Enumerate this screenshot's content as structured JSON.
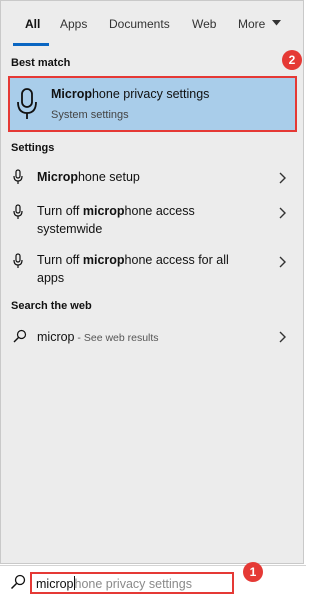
{
  "tabs": [
    {
      "label": "All"
    },
    {
      "label": "Apps"
    },
    {
      "label": "Documents"
    },
    {
      "label": "Web"
    },
    {
      "label": "More"
    }
  ],
  "sections": {
    "best_match": "Best match",
    "settings": "Settings",
    "search_web": "Search the web"
  },
  "best_match": {
    "title_bold": "Microp",
    "title_rest": "hone privacy settings",
    "subtitle": "System settings"
  },
  "settings_items": [
    {
      "pre": "",
      "bold": "Microp",
      "post": "hone setup"
    },
    {
      "pre": "Turn off ",
      "bold": "microp",
      "post": "hone access",
      "line2": "systemwide"
    },
    {
      "pre": "Turn off ",
      "bold": "microp",
      "post": "hone access for all",
      "line2": "apps"
    }
  ],
  "web_result": {
    "query": "microp",
    "hint": " - See web results"
  },
  "search": {
    "typed": "microp",
    "ghost": "hone privacy settings"
  },
  "badges": {
    "one": "1",
    "two": "2"
  },
  "colors": {
    "accent": "#0a66c2",
    "selected": "#a9cdea",
    "annotation": "#e53935"
  },
  "icons": [
    "microphone-icon",
    "chevron-right-icon",
    "search-icon",
    "caret-down-icon"
  ]
}
